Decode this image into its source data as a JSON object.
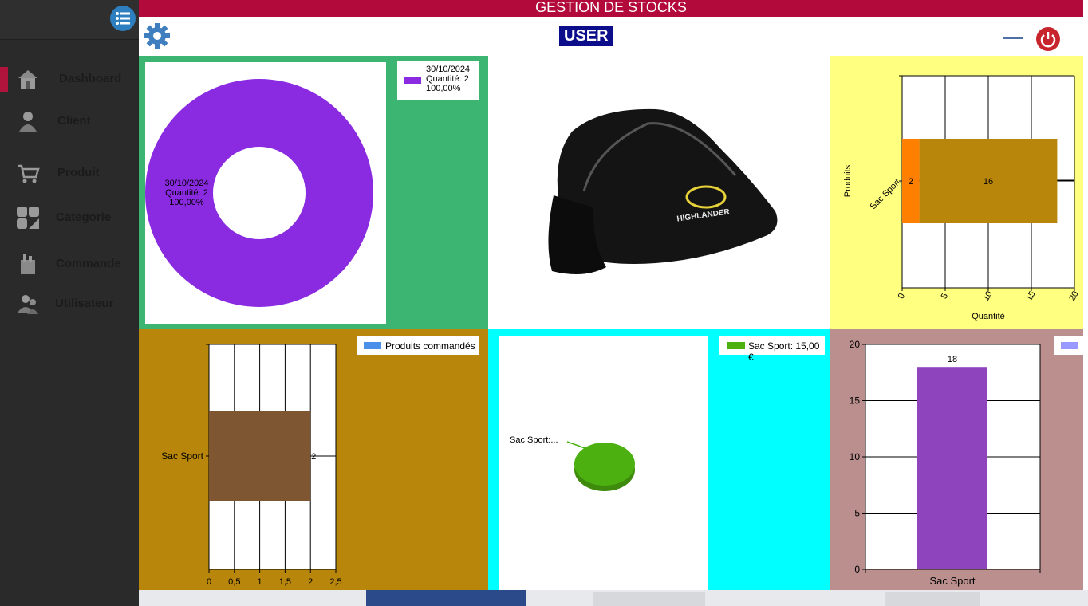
{
  "window": {
    "title": "GESTION DE STOCKS"
  },
  "header": {
    "user_label": "USER"
  },
  "sidebar": {
    "items": [
      {
        "label": "Dashboard",
        "icon": "home-icon",
        "active": true
      },
      {
        "label": "Client",
        "icon": "person-icon"
      },
      {
        "label": "Produit",
        "icon": "cart-icon"
      },
      {
        "label": "Categorie",
        "icon": "grid-icon"
      },
      {
        "label": "Commande",
        "icon": "bag-icon"
      },
      {
        "label": "Utilisateur",
        "icon": "users-icon"
      }
    ]
  },
  "colors": {
    "accent": "#b20a3a",
    "panel_green": "#3db572",
    "panel_yellow": "#ffff80",
    "panel_gold": "#b8860b",
    "panel_cyan": "#00ffff",
    "panel_rose": "#bc8f8f"
  },
  "product_image": {
    "brand_text": "HIGHLANDER"
  },
  "chart_data": [
    {
      "type": "pie",
      "variant": "doughnut",
      "slices": [
        {
          "label": "30/10/2024",
          "quantity_text": "Quantité: 2",
          "percent_text": "100,00%",
          "value": 2,
          "color": "#8a2be2"
        }
      ],
      "legend": [
        {
          "line1": "30/10/2024",
          "line2": "Quantité: 2",
          "line3": "100,00%"
        }
      ],
      "legend_position": "top-right"
    },
    {
      "type": "bar",
      "orientation": "horizontal",
      "stacked": true,
      "categories": [
        "Sac Sport"
      ],
      "series": [
        {
          "values": [
            2
          ],
          "color": "#ff7f00",
          "label": "2"
        },
        {
          "values": [
            16
          ],
          "color": "#b8860b",
          "label": "16"
        }
      ],
      "xlabel": "Quantité",
      "ylabel": "Produits",
      "xlim": [
        0,
        20
      ],
      "ticks": [
        "0",
        "5",
        "10",
        "15",
        "20"
      ]
    },
    {
      "type": "bar",
      "orientation": "horizontal",
      "categories": [
        "Sac Sport"
      ],
      "series": [
        {
          "name": "Produits commandés",
          "values": [
            2
          ],
          "color": "#7f5632",
          "label": "2"
        }
      ],
      "xlim": [
        0,
        2.5
      ],
      "ticks": [
        "0",
        "0,5",
        "1",
        "1,5",
        "2",
        "2,5"
      ],
      "legend_position": "top-right"
    },
    {
      "type": "pie",
      "variant": "3d",
      "slices": [
        {
          "label": "Sac Sport:...",
          "value": 15,
          "color": "#4cb010"
        }
      ],
      "legend": [
        {
          "text": "Sac Sport: 15,00 €"
        }
      ],
      "legend_position": "top-right"
    },
    {
      "type": "bar",
      "categories": [
        "Sac Sport"
      ],
      "series": [
        {
          "name": "",
          "values": [
            18
          ],
          "color": "#8e44bd",
          "label": "18"
        }
      ],
      "ylim": [
        0,
        20
      ],
      "ticks": [
        "0",
        "5",
        "10",
        "15",
        "20"
      ],
      "legend_position": "top-right"
    }
  ]
}
